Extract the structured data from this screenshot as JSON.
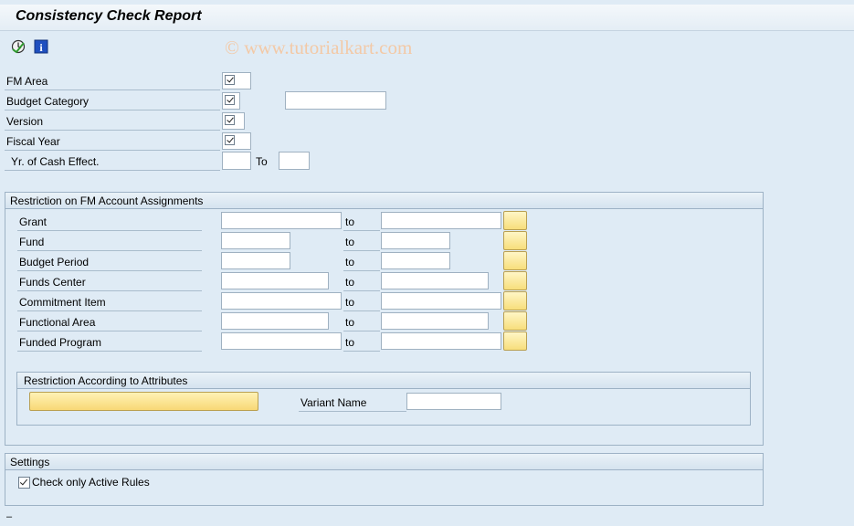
{
  "title": "Consistency Check Report",
  "watermark": "© www.tutorialkart.com",
  "toolbar": [
    {
      "name": "execute-icon",
      "glyph": "⏱"
    },
    {
      "name": "info-icon",
      "glyph": "i"
    }
  ],
  "fields": [
    {
      "label": "FM Area",
      "checked": true
    },
    {
      "label": "Budget Category",
      "checked": true
    },
    {
      "label": "Version",
      "checked": true
    },
    {
      "label": "Fiscal Year",
      "checked": true
    },
    {
      "label": "Yr. of Cash Effect.",
      "to": "To"
    }
  ],
  "restriction": {
    "heading": "Restriction on FM Account Assignments",
    "to_label": "to",
    "rows": [
      {
        "label": "Grant"
      },
      {
        "label": "Fund"
      },
      {
        "label": "Budget Period"
      },
      {
        "label": "Funds Center"
      },
      {
        "label": "Commitment Item"
      },
      {
        "label": "Functional Area"
      },
      {
        "label": "Funded Program"
      }
    ],
    "attributes": {
      "heading": "Restriction According to Attributes",
      "variant_label": "Variant Name"
    }
  },
  "settings": {
    "heading": "Settings",
    "check_label": "Check only Active Rules",
    "checked": true
  },
  "footer_mark": "–"
}
